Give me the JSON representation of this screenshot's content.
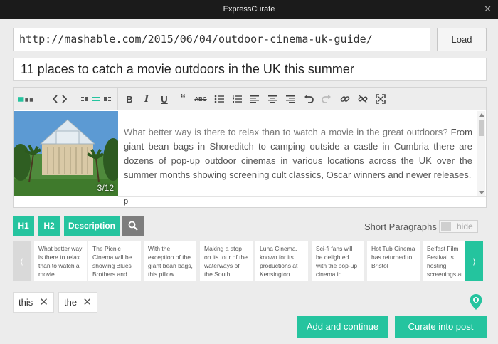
{
  "window": {
    "title": "ExpressCurate",
    "close_glyph": "✕"
  },
  "url_input": {
    "value": "http://mashable.com/2015/06/04/outdoor-cinema-uk-guide/"
  },
  "load_button": {
    "label": "Load"
  },
  "title_input": {
    "value": "11 places to catch a movie outdoors in the UK this summer"
  },
  "editor": {
    "toolbar": {
      "left_group": [
        "layout-icon",
        "code-view-icon",
        "align-image-icon"
      ],
      "format_group": [
        "bold-icon",
        "italic-icon",
        "underline-icon",
        "blockquote-icon",
        "strikethrough-icon",
        "bullet-list-icon",
        "numbered-list-icon",
        "align-left-icon",
        "align-center-icon",
        "align-right-icon",
        "undo-icon",
        "redo-icon",
        "link-icon",
        "unlink-icon",
        "fullscreen-icon"
      ]
    },
    "image_counter": "3/12",
    "text_intro": "What better way is there to relax than to watch a movie in the great outdoors?",
    "text_rest": " From giant bean bags in Shoreditch to camping outside a castle in Cumbria there are dozens of pop-up outdoor cinemas in various locations across the UK over the summer months showing screening cult classics, Oscar winners and newer releases.",
    "path": "p"
  },
  "tag_buttons": {
    "h1": "H1",
    "h2": "H2",
    "description": "Description"
  },
  "short_paragraphs": {
    "label": "Short Paragraphs",
    "toggle_label": "hide"
  },
  "paragraph_strip": {
    "prev_glyph": "⟨",
    "next_glyph": "⟩",
    "cards": [
      "What better way is there to relax than to watch a movie",
      "The Picnic Cinema will be showing Blues Brothers and",
      "With the exception of the giant bean bags, this pillow",
      "Making a stop on its tour of the waterways of the South",
      "Luna Cinema, known for its productions at Kensington",
      "Sci-fi fans will be delighted with the pop-up cinema in",
      "Hot Tub Cinema has returned to Bristol",
      "Belfast Film Festival is hosting screenings at"
    ]
  },
  "keywords": [
    {
      "label": "this"
    },
    {
      "label": "the"
    }
  ],
  "chip_remove_glyph": "✕",
  "actions": {
    "add_continue": "Add and continue",
    "curate": "Curate into post"
  },
  "colors": {
    "accent": "#25c49f",
    "titlebar": "#1b1b1b",
    "search_button": "#7d7d7d"
  }
}
